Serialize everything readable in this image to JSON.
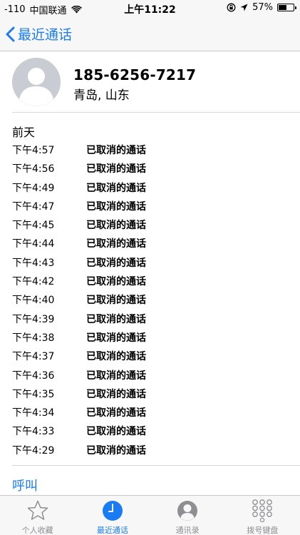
{
  "status_bar": {
    "signal": "-110",
    "carrier": "中国联通",
    "time": "上午11:22",
    "battery": "57%",
    "battery_level": 0.57
  },
  "nav": {
    "back_label": "最近通话"
  },
  "contact": {
    "number": "185-6256-7217",
    "location": "青岛, 山东"
  },
  "date_header": "前天",
  "calls": [
    {
      "time": "下午4:57",
      "status": "已取消的通话"
    },
    {
      "time": "下午4:56",
      "status": "已取消的通话"
    },
    {
      "time": "下午4:49",
      "status": "已取消的通话"
    },
    {
      "time": "下午4:47",
      "status": "已取消的通话"
    },
    {
      "time": "下午4:45",
      "status": "已取消的通话"
    },
    {
      "time": "下午4:44",
      "status": "已取消的通话"
    },
    {
      "time": "下午4:43",
      "status": "已取消的通话"
    },
    {
      "time": "下午4:42",
      "status": "已取消的通话"
    },
    {
      "time": "下午4:40",
      "status": "已取消的通话"
    },
    {
      "time": "下午4:39",
      "status": "已取消的通话"
    },
    {
      "time": "下午4:38",
      "status": "已取消的通话"
    },
    {
      "time": "下午4:37",
      "status": "已取消的通话"
    },
    {
      "time": "下午4:36",
      "status": "已取消的通话"
    },
    {
      "time": "下午4:35",
      "status": "已取消的通话"
    },
    {
      "time": "下午4:34",
      "status": "已取消的通话"
    },
    {
      "time": "下午4:33",
      "status": "已取消的通话"
    },
    {
      "time": "下午4:29",
      "status": "已取消的通话"
    }
  ],
  "call_action": "呼叫",
  "tabs": [
    {
      "label": "个人收藏",
      "icon": "star-icon"
    },
    {
      "label": "最近通话",
      "icon": "clock-icon",
      "active": true
    },
    {
      "label": "通讯录",
      "icon": "person-circle-icon"
    },
    {
      "label": "拨号键盘",
      "icon": "keypad-icon"
    }
  ],
  "colors": {
    "accent": "#1a7cf5",
    "inactive": "#8e8e93"
  }
}
